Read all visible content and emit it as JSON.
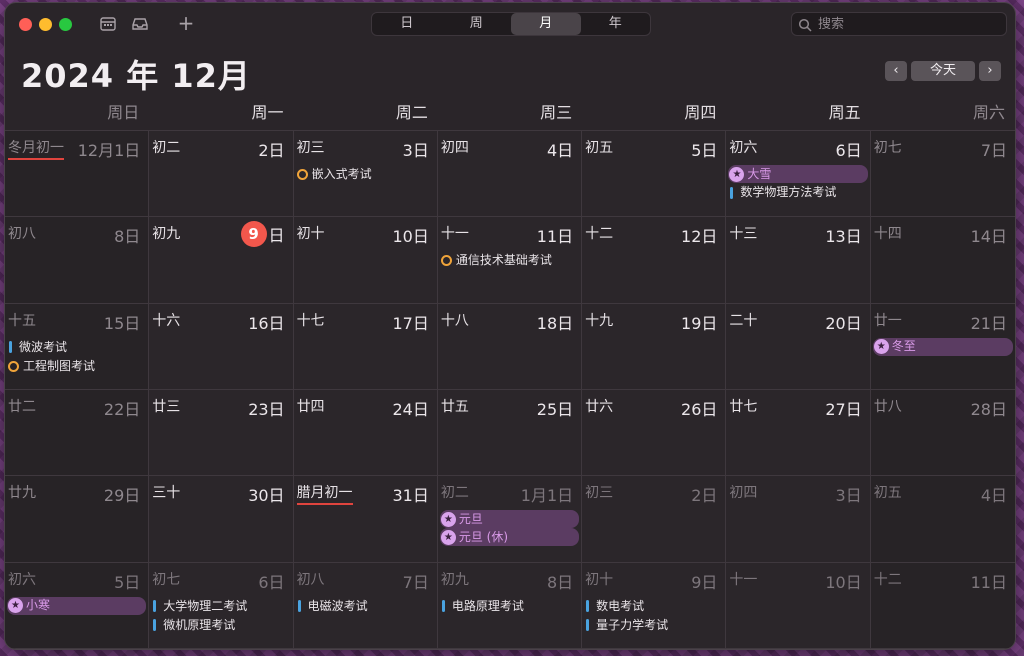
{
  "toolbar": {
    "views": [
      "日",
      "周",
      "月",
      "年"
    ],
    "active_view": 2,
    "add_label": "+",
    "search_placeholder": "搜索"
  },
  "header": {
    "title": "2024 年 12月",
    "prev": "‹",
    "today": "今天",
    "next": "›"
  },
  "weekdays": [
    "周日",
    "周一",
    "周二",
    "周三",
    "周四",
    "周五",
    "周六"
  ],
  "colors": {
    "today": "#f2574c",
    "event_bar": "#4aa3e0",
    "event_ring": "#f0a43a",
    "holiday_bg": "#5b3c62",
    "holiday_text": "#d99ae8"
  },
  "weeks": [
    [
      {
        "lunar": "冬月初一",
        "solar": "12月1日",
        "underline": true
      },
      {
        "lunar": "初二",
        "solar": "2日"
      },
      {
        "lunar": "初三",
        "solar": "3日",
        "events": [
          {
            "type": "ring",
            "title": "嵌入式考试"
          }
        ]
      },
      {
        "lunar": "初四",
        "solar": "4日"
      },
      {
        "lunar": "初五",
        "solar": "5日"
      },
      {
        "lunar": "初六",
        "solar": "6日",
        "events": [
          {
            "type": "holiday",
            "title": "大雪"
          },
          {
            "type": "bar",
            "title": "数学物理方法考试"
          }
        ]
      },
      {
        "lunar": "初七",
        "solar": "7日"
      }
    ],
    [
      {
        "lunar": "初八",
        "solar": "8日"
      },
      {
        "lunar": "初九",
        "solar": "日",
        "today_num": "9"
      },
      {
        "lunar": "初十",
        "solar": "10日"
      },
      {
        "lunar": "十一",
        "solar": "11日",
        "events": [
          {
            "type": "ring",
            "title": "通信技术基础考试"
          }
        ]
      },
      {
        "lunar": "十二",
        "solar": "12日"
      },
      {
        "lunar": "十三",
        "solar": "13日"
      },
      {
        "lunar": "十四",
        "solar": "14日"
      }
    ],
    [
      {
        "lunar": "十五",
        "solar": "15日",
        "events": [
          {
            "type": "bar",
            "title": "微波考试"
          },
          {
            "type": "ring",
            "title": "工程制图考试"
          }
        ]
      },
      {
        "lunar": "十六",
        "solar": "16日"
      },
      {
        "lunar": "十七",
        "solar": "17日"
      },
      {
        "lunar": "十八",
        "solar": "18日"
      },
      {
        "lunar": "十九",
        "solar": "19日"
      },
      {
        "lunar": "二十",
        "solar": "20日"
      },
      {
        "lunar": "廿一",
        "solar": "21日",
        "events": [
          {
            "type": "holiday",
            "title": "冬至"
          }
        ]
      }
    ],
    [
      {
        "lunar": "廿二",
        "solar": "22日"
      },
      {
        "lunar": "廿三",
        "solar": "23日"
      },
      {
        "lunar": "廿四",
        "solar": "24日"
      },
      {
        "lunar": "廿五",
        "solar": "25日"
      },
      {
        "lunar": "廿六",
        "solar": "26日"
      },
      {
        "lunar": "廿七",
        "solar": "27日"
      },
      {
        "lunar": "廿八",
        "solar": "28日"
      }
    ],
    [
      {
        "lunar": "廿九",
        "solar": "29日"
      },
      {
        "lunar": "三十",
        "solar": "30日"
      },
      {
        "lunar": "腊月初一",
        "solar": "31日",
        "underline": true
      },
      {
        "lunar": "初二",
        "solar": "1月1日",
        "other": true,
        "events": [
          {
            "type": "holiday",
            "title": "元旦"
          },
          {
            "type": "holiday",
            "title": "元旦 (休)"
          }
        ]
      },
      {
        "lunar": "初三",
        "solar": "2日",
        "other": true
      },
      {
        "lunar": "初四",
        "solar": "3日",
        "other": true
      },
      {
        "lunar": "初五",
        "solar": "4日",
        "other": true
      }
    ],
    [
      {
        "lunar": "初六",
        "solar": "5日",
        "other": true,
        "events": [
          {
            "type": "holiday",
            "title": "小寒"
          }
        ]
      },
      {
        "lunar": "初七",
        "solar": "6日",
        "other": true,
        "events": [
          {
            "type": "bar",
            "title": "大学物理二考试"
          },
          {
            "type": "bar",
            "title": "微机原理考试"
          }
        ]
      },
      {
        "lunar": "初八",
        "solar": "7日",
        "other": true,
        "events": [
          {
            "type": "bar",
            "title": "电磁波考试"
          }
        ]
      },
      {
        "lunar": "初九",
        "solar": "8日",
        "other": true,
        "events": [
          {
            "type": "bar",
            "title": "电路原理考试"
          }
        ]
      },
      {
        "lunar": "初十",
        "solar": "9日",
        "other": true,
        "events": [
          {
            "type": "bar",
            "title": "数电考试"
          },
          {
            "type": "bar",
            "title": "量子力学考试"
          }
        ]
      },
      {
        "lunar": "十一",
        "solar": "10日",
        "other": true
      },
      {
        "lunar": "十二",
        "solar": "11日",
        "other": true
      }
    ]
  ]
}
